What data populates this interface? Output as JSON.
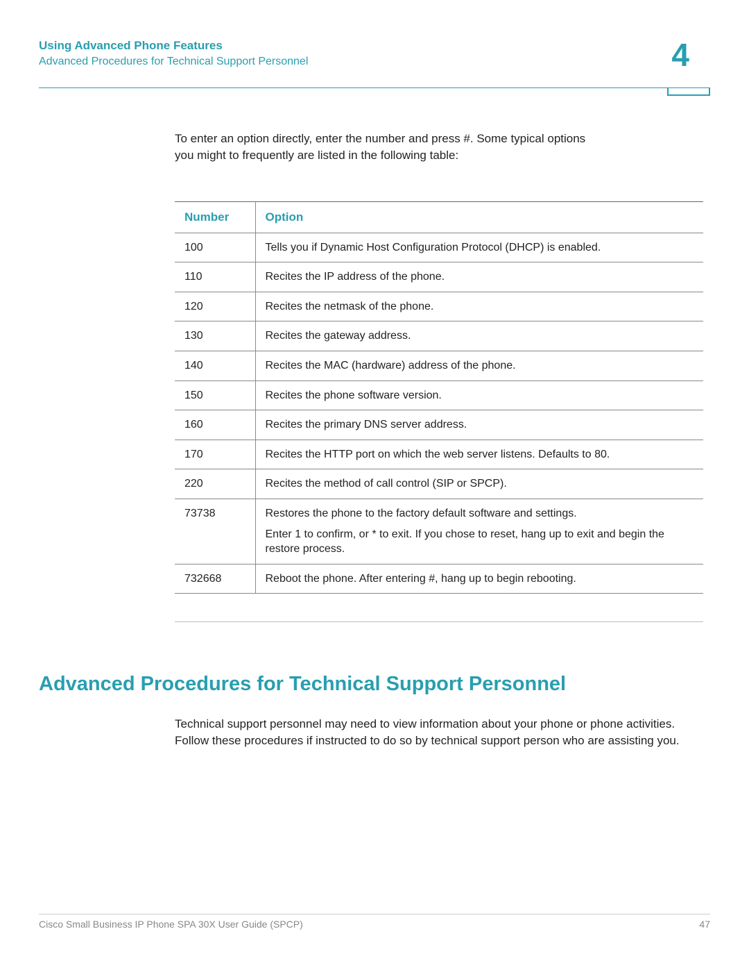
{
  "header": {
    "title": "Using Advanced Phone Features",
    "subtitle": "Advanced Procedures for Technical Support Personnel",
    "chapter": "4"
  },
  "intro": {
    "line1": "To enter an option directly, enter the number and press #. Some typical options",
    "line2": "you might to frequently are listed in the following table:"
  },
  "table": {
    "headers": {
      "col1": "Number",
      "col2": "Option"
    },
    "rows": [
      {
        "num": "100",
        "opt": "Tells you if Dynamic Host Configuration Protocol (DHCP) is enabled."
      },
      {
        "num": "110",
        "opt": "Recites the IP address of the phone."
      },
      {
        "num": "120",
        "opt": "Recites the netmask of the phone."
      },
      {
        "num": "130",
        "opt": "Recites the gateway address."
      },
      {
        "num": "140",
        "opt": "Recites the MAC (hardware) address of the phone."
      },
      {
        "num": "150",
        "opt": "Recites the phone software version."
      },
      {
        "num": "160",
        "opt": "Recites the primary DNS server address."
      },
      {
        "num": "170",
        "opt": "Recites the HTTP port on which the web server listens. Defaults to 80."
      },
      {
        "num": "220",
        "opt": "Recites the method of call control (SIP or SPCP)."
      },
      {
        "num": "73738",
        "opt": "Restores the phone to the factory default software and settings.",
        "opt2": "Enter 1 to confirm, or * to exit. If you chose to reset, hang up to exit and begin the restore process."
      },
      {
        "num": "732668",
        "opt": "Reboot the phone. After entering #, hang up to begin rebooting."
      }
    ]
  },
  "section": {
    "heading": "Advanced Procedures for Technical Support Personnel",
    "body": "Technical support personnel may need to view information about your phone or phone activities. Follow these procedures if instructed to do so by technical support person who are assisting you."
  },
  "footer": {
    "left": "Cisco Small Business IP Phone SPA 30X User Guide (SPCP)",
    "right": "47"
  }
}
